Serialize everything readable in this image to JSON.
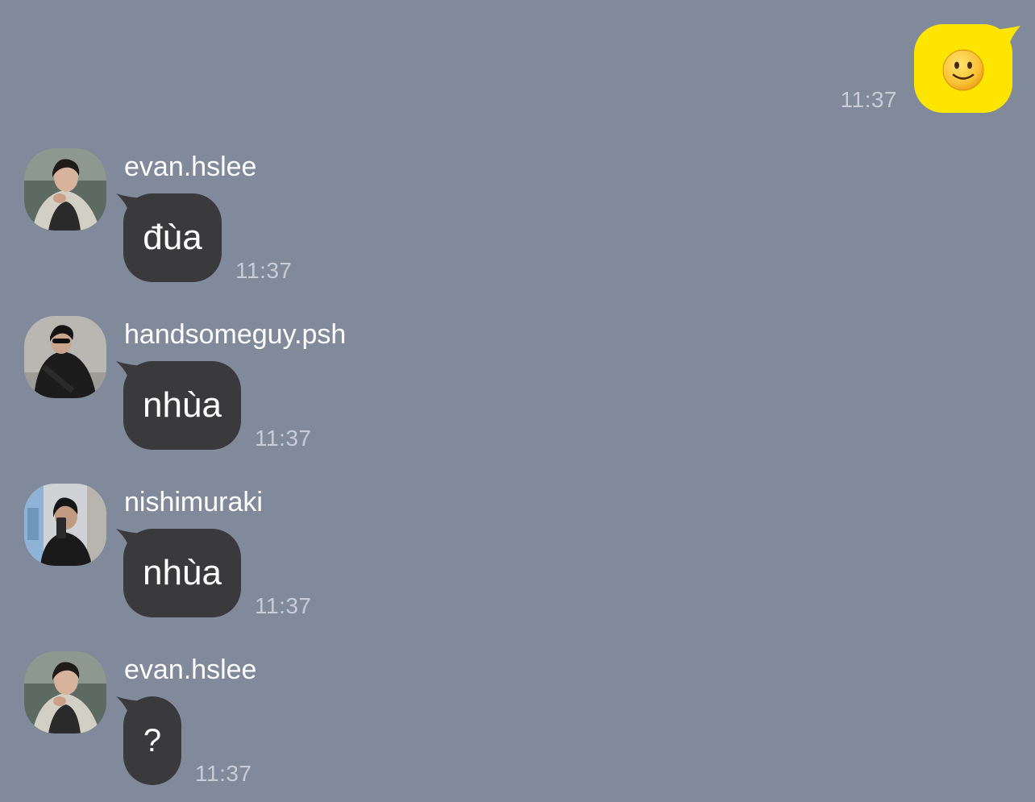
{
  "colors": {
    "background": "#818a9b",
    "outgoing_bubble": "#fee500",
    "incoming_bubble": "#3a3a3d",
    "timestamp": "#c7ccd6",
    "text": "#ffffff"
  },
  "outgoing": {
    "content_icon": "slightly-smiling-face-emoji",
    "time": "11:37"
  },
  "messages": [
    {
      "sender": "evan.hslee",
      "text": "đùa",
      "time": "11:37",
      "avatar": "avatar-photo"
    },
    {
      "sender": "handsomeguy.psh",
      "text": "nhùa",
      "time": "11:37",
      "avatar": "avatar-photo"
    },
    {
      "sender": "nishimuraki",
      "text": "nhùa",
      "time": "11:37",
      "avatar": "avatar-photo"
    },
    {
      "sender": "evan.hslee",
      "text": "?",
      "time": "11:37",
      "avatar": "avatar-photo"
    }
  ]
}
